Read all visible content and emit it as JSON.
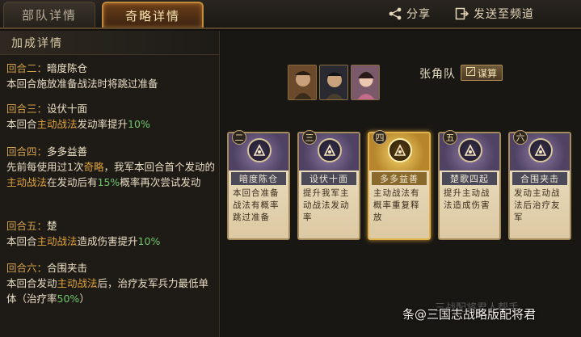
{
  "tabs": [
    {
      "label": "部队详情"
    },
    {
      "label": "奇略详情"
    }
  ],
  "actions": {
    "share": "分享",
    "send": "发送至频道"
  },
  "left": {
    "header": "加成详情",
    "bonuses": [
      {
        "round": "回合二：",
        "title": "暗度陈仓",
        "segments": [
          {
            "t": "本回合施放准备战法时将跳过准备",
            "c": ""
          }
        ]
      },
      {
        "round": "回合三：",
        "title": "设伏十面",
        "segments": [
          {
            "t": "本回合",
            "c": ""
          },
          {
            "t": "主动战法",
            "c": "hl"
          },
          {
            "t": "发动率提升",
            "c": ""
          },
          {
            "t": "10%",
            "c": "gr"
          }
        ]
      },
      {
        "round": "回合四：",
        "title": "多多益善",
        "segments": [
          {
            "t": "先前每使用过1次",
            "c": ""
          },
          {
            "t": "奇略",
            "c": "hl"
          },
          {
            "t": "，我军本回合首个发动的",
            "c": ""
          },
          {
            "t": "主动战法",
            "c": "hl"
          },
          {
            "t": "在发动后有",
            "c": ""
          },
          {
            "t": "15%",
            "c": "gr"
          },
          {
            "t": "概率再次尝试发动",
            "c": ""
          }
        ]
      },
      {
        "round": "回合五：",
        "title": "楚",
        "segments": [
          {
            "t": "本回合",
            "c": ""
          },
          {
            "t": "主动战法",
            "c": "hl"
          },
          {
            "t": "造成伤害提升",
            "c": ""
          },
          {
            "t": "10%",
            "c": "gr"
          }
        ]
      },
      {
        "round": "回合六：",
        "title": "合围夹击",
        "segments": [
          {
            "t": "本回合发动",
            "c": ""
          },
          {
            "t": "主动战法",
            "c": "hl"
          },
          {
            "t": "后，治疗友军兵力最低单体（治疗率",
            "c": ""
          },
          {
            "t": "50%",
            "c": "gr"
          },
          {
            "t": "）",
            "c": ""
          }
        ]
      }
    ]
  },
  "team": {
    "name": "张角队",
    "button": "谋算",
    "portraits": [
      "portrait-1",
      "portrait-2",
      "portrait-3"
    ]
  },
  "cards": [
    {
      "num": "二",
      "name": "暗度陈仓",
      "desc": "本回合准备战法有概率跳过准备",
      "gold": false
    },
    {
      "num": "三",
      "name": "设伏十面",
      "desc": "提升我军主动战法发动率",
      "gold": false
    },
    {
      "num": "四",
      "name": "多多益善",
      "desc": "主动战法有概率重复释放",
      "gold": true
    },
    {
      "num": "五",
      "name": "楚歌四起",
      "desc": "提升主动战法造成伤害",
      "gold": false
    },
    {
      "num": "六",
      "name": "合围夹击",
      "desc": "发动主动战法后治疗友军",
      "gold": false
    }
  ],
  "watermark": "条@三国志战略版配将君",
  "watermark_faint": "三战配将君人帮手"
}
